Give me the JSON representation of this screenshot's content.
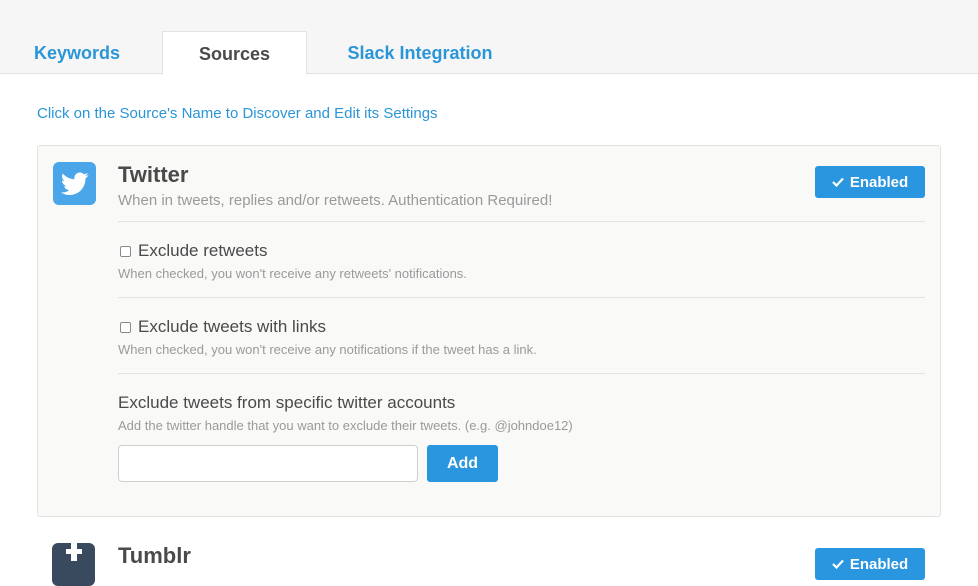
{
  "tabs": [
    {
      "label": "Keywords",
      "active": false
    },
    {
      "label": "Sources",
      "active": true
    },
    {
      "label": "Slack Integration",
      "active": false
    }
  ],
  "hint": "Click on the Source's Name to Discover and Edit its Settings",
  "colors": {
    "accent": "#2a96e0",
    "twitter": "#4aa6e8",
    "tumblr": "#3a4a5e"
  },
  "sources": [
    {
      "name": "Twitter",
      "icon": "twitter-bird-icon",
      "description": "When in tweets, replies and/or retweets. Authentication Required!",
      "status_label": "Enabled",
      "options": [
        {
          "label": "Exclude retweets",
          "help": "When checked, you won't receive any retweets' notifications.",
          "checked": false
        },
        {
          "label": "Exclude tweets with links",
          "help": "When checked, you won't receive any notifications if the tweet has a link.",
          "checked": false
        }
      ],
      "exclude_accounts": {
        "label": "Exclude tweets from specific twitter accounts",
        "help": "Add the twitter handle that you want to exclude their tweets. (e.g. @johndoe12)",
        "input_value": "",
        "add_label": "Add"
      }
    },
    {
      "name": "Tumblr",
      "icon": "tumblr-icon",
      "status_label": "Enabled"
    }
  ]
}
